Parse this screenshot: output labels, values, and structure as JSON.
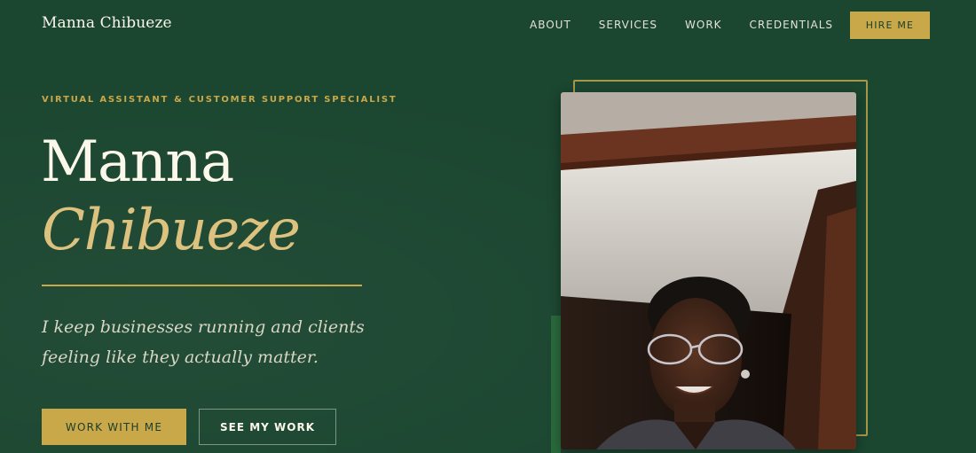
{
  "nav": {
    "brand": "Manna Chibueze",
    "links": [
      "ABOUT",
      "SERVICES",
      "WORK",
      "CREDENTIALS"
    ],
    "cta": "HIRE ME"
  },
  "hero": {
    "eyebrow_left": "VIRTUAL ASSISTANT",
    "eyebrow_amp": "&",
    "eyebrow_right": "CUSTOMER SUPPORT SPECIALIST",
    "name_first": "Manna",
    "name_last": "Chibueze",
    "tagline": "I keep businesses running and clients feeling like they actually matter.",
    "primary_button": "WORK WITH ME",
    "secondary_button": "SEE MY WORK"
  },
  "colors": {
    "background": "#1b4630",
    "accent_gold": "#c9a84a",
    "name_gold": "#dcc27e",
    "text_light": "#fbf7ea"
  }
}
